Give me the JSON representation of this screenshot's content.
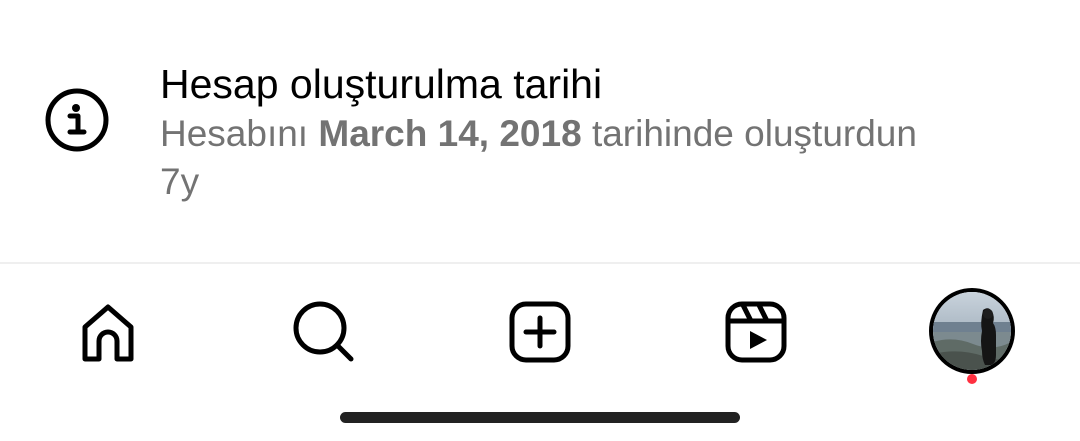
{
  "account_info": {
    "icon": "info-icon",
    "title": "Hesap oluşturulma tarihi",
    "desc_prefix": "Hesabını ",
    "date": "March 14, 2018",
    "desc_suffix": " tarihinde oluşturdun",
    "age": "7y"
  },
  "tabbar": {
    "tabs": [
      {
        "icon": "home-icon"
      },
      {
        "icon": "search-icon"
      },
      {
        "icon": "create-plus-icon"
      },
      {
        "icon": "reels-icon"
      },
      {
        "icon": "profile-avatar"
      }
    ],
    "notification_color": "#ff3040"
  }
}
